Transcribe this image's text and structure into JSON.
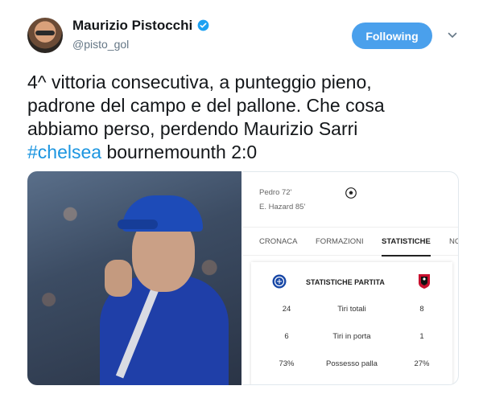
{
  "author": {
    "name": "Maurizio Pistocchi",
    "handle": "@pisto_gol",
    "verified": true
  },
  "follow_button": {
    "label": "Following",
    "color": "#4aa0ec"
  },
  "tweet": {
    "lines": [
      "4^ vittoria consecutiva, a punteggio pieno,",
      "padrone del campo e del pallone. Che cosa",
      "abbiamo perso, perdendo Maurizio Sarri"
    ],
    "hashtag": "#chelsea",
    "tail": " bournemounth 2:0",
    "hashtag_color": "#1b95e0"
  },
  "match_panel": {
    "scorers": [
      "Pedro 72'",
      "E. Hazard 85'"
    ],
    "tabs": [
      {
        "label": "CRONACA",
        "active": false
      },
      {
        "label": "FORMAZIONI",
        "active": false
      },
      {
        "label": "STATISTICHE",
        "active": true
      },
      {
        "label": "NC",
        "active": false
      }
    ],
    "stats_title": "STATISTICHE PARTITA",
    "home_team_icon": "chelsea-crest",
    "away_team_icon": "bournemouth-crest",
    "stats": [
      {
        "home": "24",
        "label": "Tiri totali",
        "away": "8"
      },
      {
        "home": "6",
        "label": "Tiri in porta",
        "away": "1"
      },
      {
        "home": "73%",
        "label": "Possesso palla",
        "away": "27%"
      }
    ]
  }
}
